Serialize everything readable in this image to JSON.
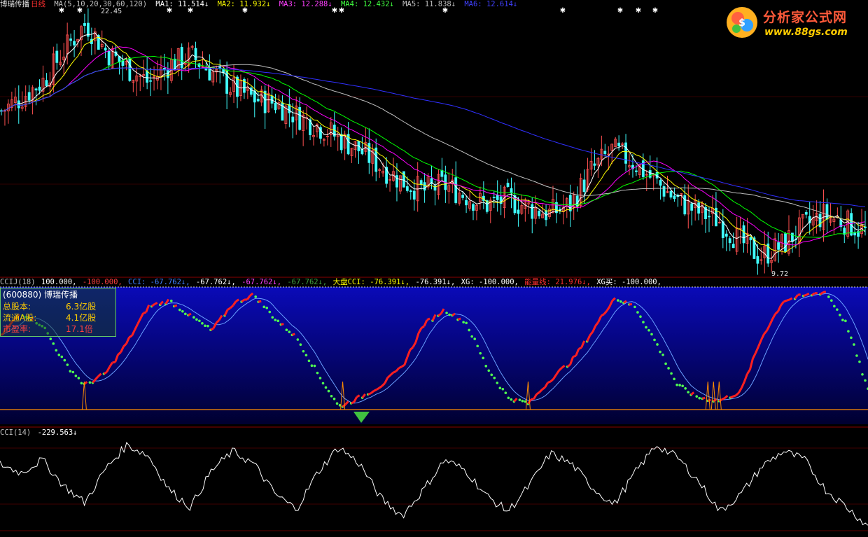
{
  "header": {
    "stock_name": "博瑞传播",
    "period": "日线",
    "ma_params": "MA(5,10,20,30,60,120)",
    "ma1": "MA1: 11.514↓",
    "ma2": "MA2: 11.932↓",
    "ma3": "MA3: 12.288↓",
    "ma4": "MA4: 12.432↓",
    "ma5": "MA5: 11.838↓",
    "ma6": "MA6: 12.614↓",
    "high_label": "22.45",
    "low_label": "9.72"
  },
  "cci_panel": {
    "name": "CCIJ(18)",
    "v1": "100.000,",
    "v2": "-100.000,",
    "cci": "CCI: -67.762↓,",
    "v3": "-67.762↓,",
    "v4": "-67.762↓,",
    "v5": "-67.762↓,",
    "dapan": "大盘CCI: -76.391↓,",
    "v6": "-76.391↓,",
    "xg": "XG: -100.000,",
    "nengliang": "能量线: 21.976↓,",
    "xgmai": "XG买: -100.000,"
  },
  "info_box": {
    "title": "(600880)  博瑞传播",
    "rows": [
      {
        "label": "总股本:",
        "value": "6.3亿股"
      },
      {
        "label": "流通A股:",
        "value": "4.1亿股"
      },
      {
        "label": "市盈率:",
        "value": "17.1倍"
      }
    ]
  },
  "cci14_panel": {
    "name": "CCI(14)",
    "value": "-229.563↓"
  },
  "logo": {
    "title": "分析家公式网",
    "url": "www.88gs.com"
  },
  "colors": {
    "ma1": "#ffffff",
    "ma2": "#ffff00",
    "ma3": "#ff00ff",
    "ma4": "#00ff00",
    "ma5": "#c0c0c0",
    "ma6": "#3030ff",
    "up": "#ff5050",
    "down": "#40ffff",
    "cci_bg_top": "#0a0ab0",
    "cci_bg_bottom": "#000030",
    "red_line": "#ff2020",
    "green_dot": "#50ff50",
    "orange": "#ff8c00"
  },
  "chart_data": [
    {
      "type": "candlestick",
      "title": "博瑞传播 日线",
      "ylim": [
        9.72,
        22.45
      ],
      "annotations": [
        "22.45",
        "9.72"
      ],
      "moving_averages": [
        "MA1",
        "MA2",
        "MA3",
        "MA4",
        "MA5",
        "MA6"
      ],
      "close_trend": [
        17.5,
        18.2,
        19.0,
        20.5,
        21.8,
        20.4,
        19.6,
        18.9,
        19.8,
        20.2,
        19.4,
        18.6,
        18.1,
        17.9,
        17.3,
        16.8,
        16.2,
        15.6,
        14.8,
        14.1,
        13.6,
        13.9,
        13.4,
        12.9,
        13.2,
        12.8,
        12.5,
        12.9,
        14.6,
        15.6,
        15.0,
        14.1,
        13.2,
        12.6,
        12.2,
        11.2,
        10.4,
        10.9,
        11.8,
        12.4,
        12.1,
        11.6
      ]
    },
    {
      "type": "line",
      "title": "CCIJ(18)",
      "ylim": [
        -100,
        100
      ],
      "series": [
        {
          "name": "CCI",
          "values": [
            20,
            60,
            40,
            -20,
            -60,
            -40,
            10,
            70,
            80,
            55,
            30,
            75,
            90,
            50,
            20,
            -40,
            -95,
            -80,
            -60,
            -30,
            40,
            65,
            45,
            -30,
            -80,
            -90,
            -50,
            -20,
            30,
            85,
            70,
            10,
            -60,
            -80,
            -85,
            -70,
            20,
            80,
            88,
            95,
            40,
            -67.762
          ]
        }
      ]
    },
    {
      "type": "line",
      "title": "CCI(14)",
      "series": [
        {
          "name": "CCI(14)",
          "values": [
            60,
            20,
            80,
            -40,
            -120,
            40,
            150,
            100,
            -60,
            -140,
            30,
            120,
            60,
            -80,
            -150,
            20,
            140,
            60,
            -100,
            -180,
            -60,
            80,
            30,
            -90,
            -160,
            -40,
            110,
            60,
            -50,
            -130,
            20,
            150,
            90,
            -20,
            -160,
            -80,
            50,
            120,
            80,
            -60,
            -140,
            -229.563
          ]
        }
      ]
    }
  ]
}
